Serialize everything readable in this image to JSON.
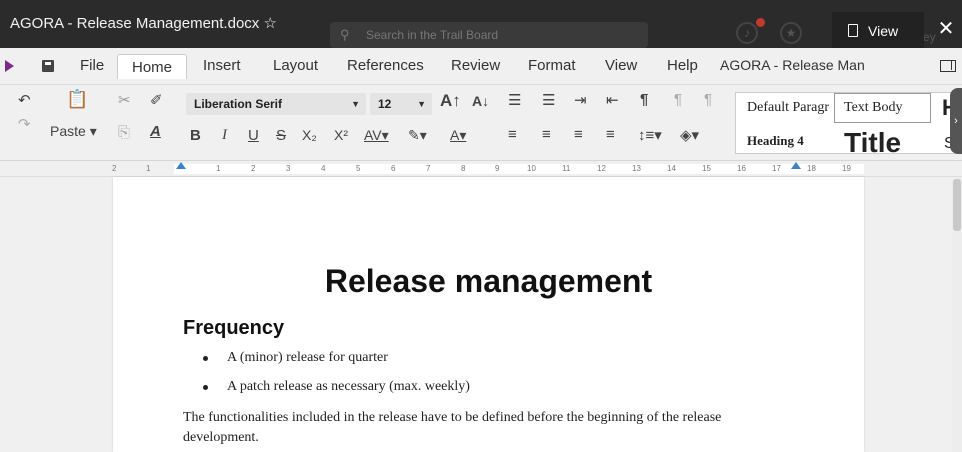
{
  "window": {
    "title": "AGORA - Release Management.docx ☆"
  },
  "header": {
    "search_placeholder": "Search in the Trail Board",
    "user_name": "Walt Disney",
    "view_label": "View",
    "close_label": "✕"
  },
  "menu": {
    "file": "File",
    "home": "Home",
    "insert": "Insert",
    "layout": "Layout",
    "references": "References",
    "review": "Review",
    "format": "Format",
    "view": "View",
    "help": "Help",
    "doc_name": "AGORA - Release Man"
  },
  "toolbar": {
    "paste": "Paste ▾",
    "font_family": "Liberation Serif",
    "font_size": "12",
    "styles": {
      "default": "Default Paragr",
      "text_body": "Text Body",
      "heading1": "H",
      "heading4": "Heading 4",
      "title": "Title",
      "subtitle": "S"
    }
  },
  "ruler": {
    "ticks": [
      "2",
      "1",
      "1",
      "2",
      "3",
      "4",
      "5",
      "6",
      "7",
      "8",
      "9",
      "10",
      "11",
      "12",
      "13",
      "14",
      "15",
      "16",
      "17",
      "18",
      "19"
    ]
  },
  "document": {
    "title": "Release management",
    "heading": "Frequency",
    "bullets": [
      "A (minor) release for quarter",
      "A patch release as necessary (max. weekly)"
    ],
    "paragraph": "The functionalities included in the release have to be defined before the beginning of the release development."
  },
  "colors": {
    "accent": "#7b2a8a",
    "titlebar": "#2b2b2b",
    "ruler_marker": "#3b82c4"
  }
}
